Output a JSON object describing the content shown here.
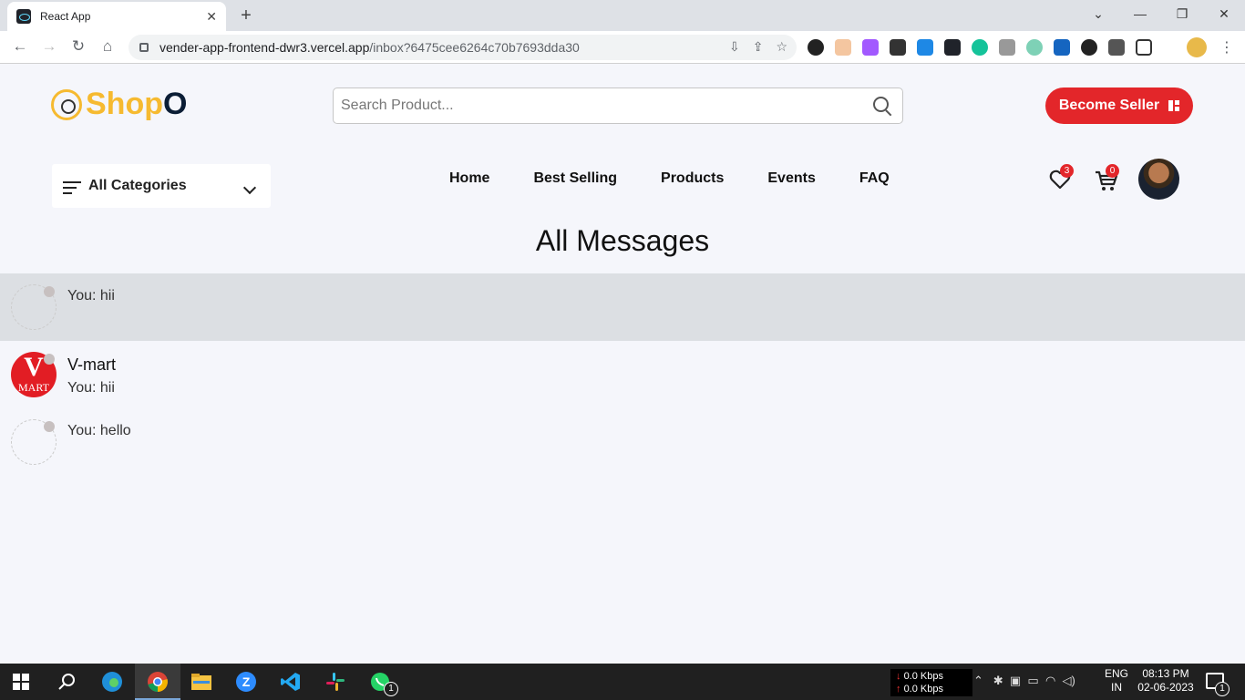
{
  "browser": {
    "tab_title": "React App",
    "url_host": "vender-app-frontend-dwr3.vercel.app",
    "url_path": "/inbox?6475cee6264c70b7693dda30"
  },
  "header": {
    "logo_text": "Shop",
    "logo_accent": "O",
    "search_placeholder": "Search Product...",
    "become_seller_label": "Become Seller"
  },
  "categories": {
    "label": "All Categories"
  },
  "nav": {
    "items": [
      {
        "label": "Home"
      },
      {
        "label": "Best Selling"
      },
      {
        "label": "Products"
      },
      {
        "label": "Events"
      },
      {
        "label": "FAQ"
      }
    ]
  },
  "icons": {
    "wishlist_count": "3",
    "cart_count": "0"
  },
  "inbox": {
    "title": "All Messages",
    "messages": [
      {
        "name": "",
        "preview": "You: hii",
        "active": true
      },
      {
        "name": "V-mart",
        "preview": "You: hii",
        "avatar_text": [
          "V",
          "MART"
        ],
        "active": false
      },
      {
        "name": "",
        "preview": "You: hello",
        "active": false
      }
    ]
  },
  "taskbar": {
    "net_down": "0.0 Kbps",
    "net_up": "0.0 Kbps",
    "lang_1": "ENG",
    "lang_2": "IN",
    "time": "08:13 PM",
    "date": "02-06-2023",
    "notification_count": "1",
    "whatsapp_badge": "1"
  },
  "colors": {
    "brand_yellow": "#f6ba30",
    "brand_dark": "#0b1d35",
    "accent_red": "#e3262a",
    "page_bg": "#f5f6fb",
    "active_row": "#dcdfe3"
  }
}
